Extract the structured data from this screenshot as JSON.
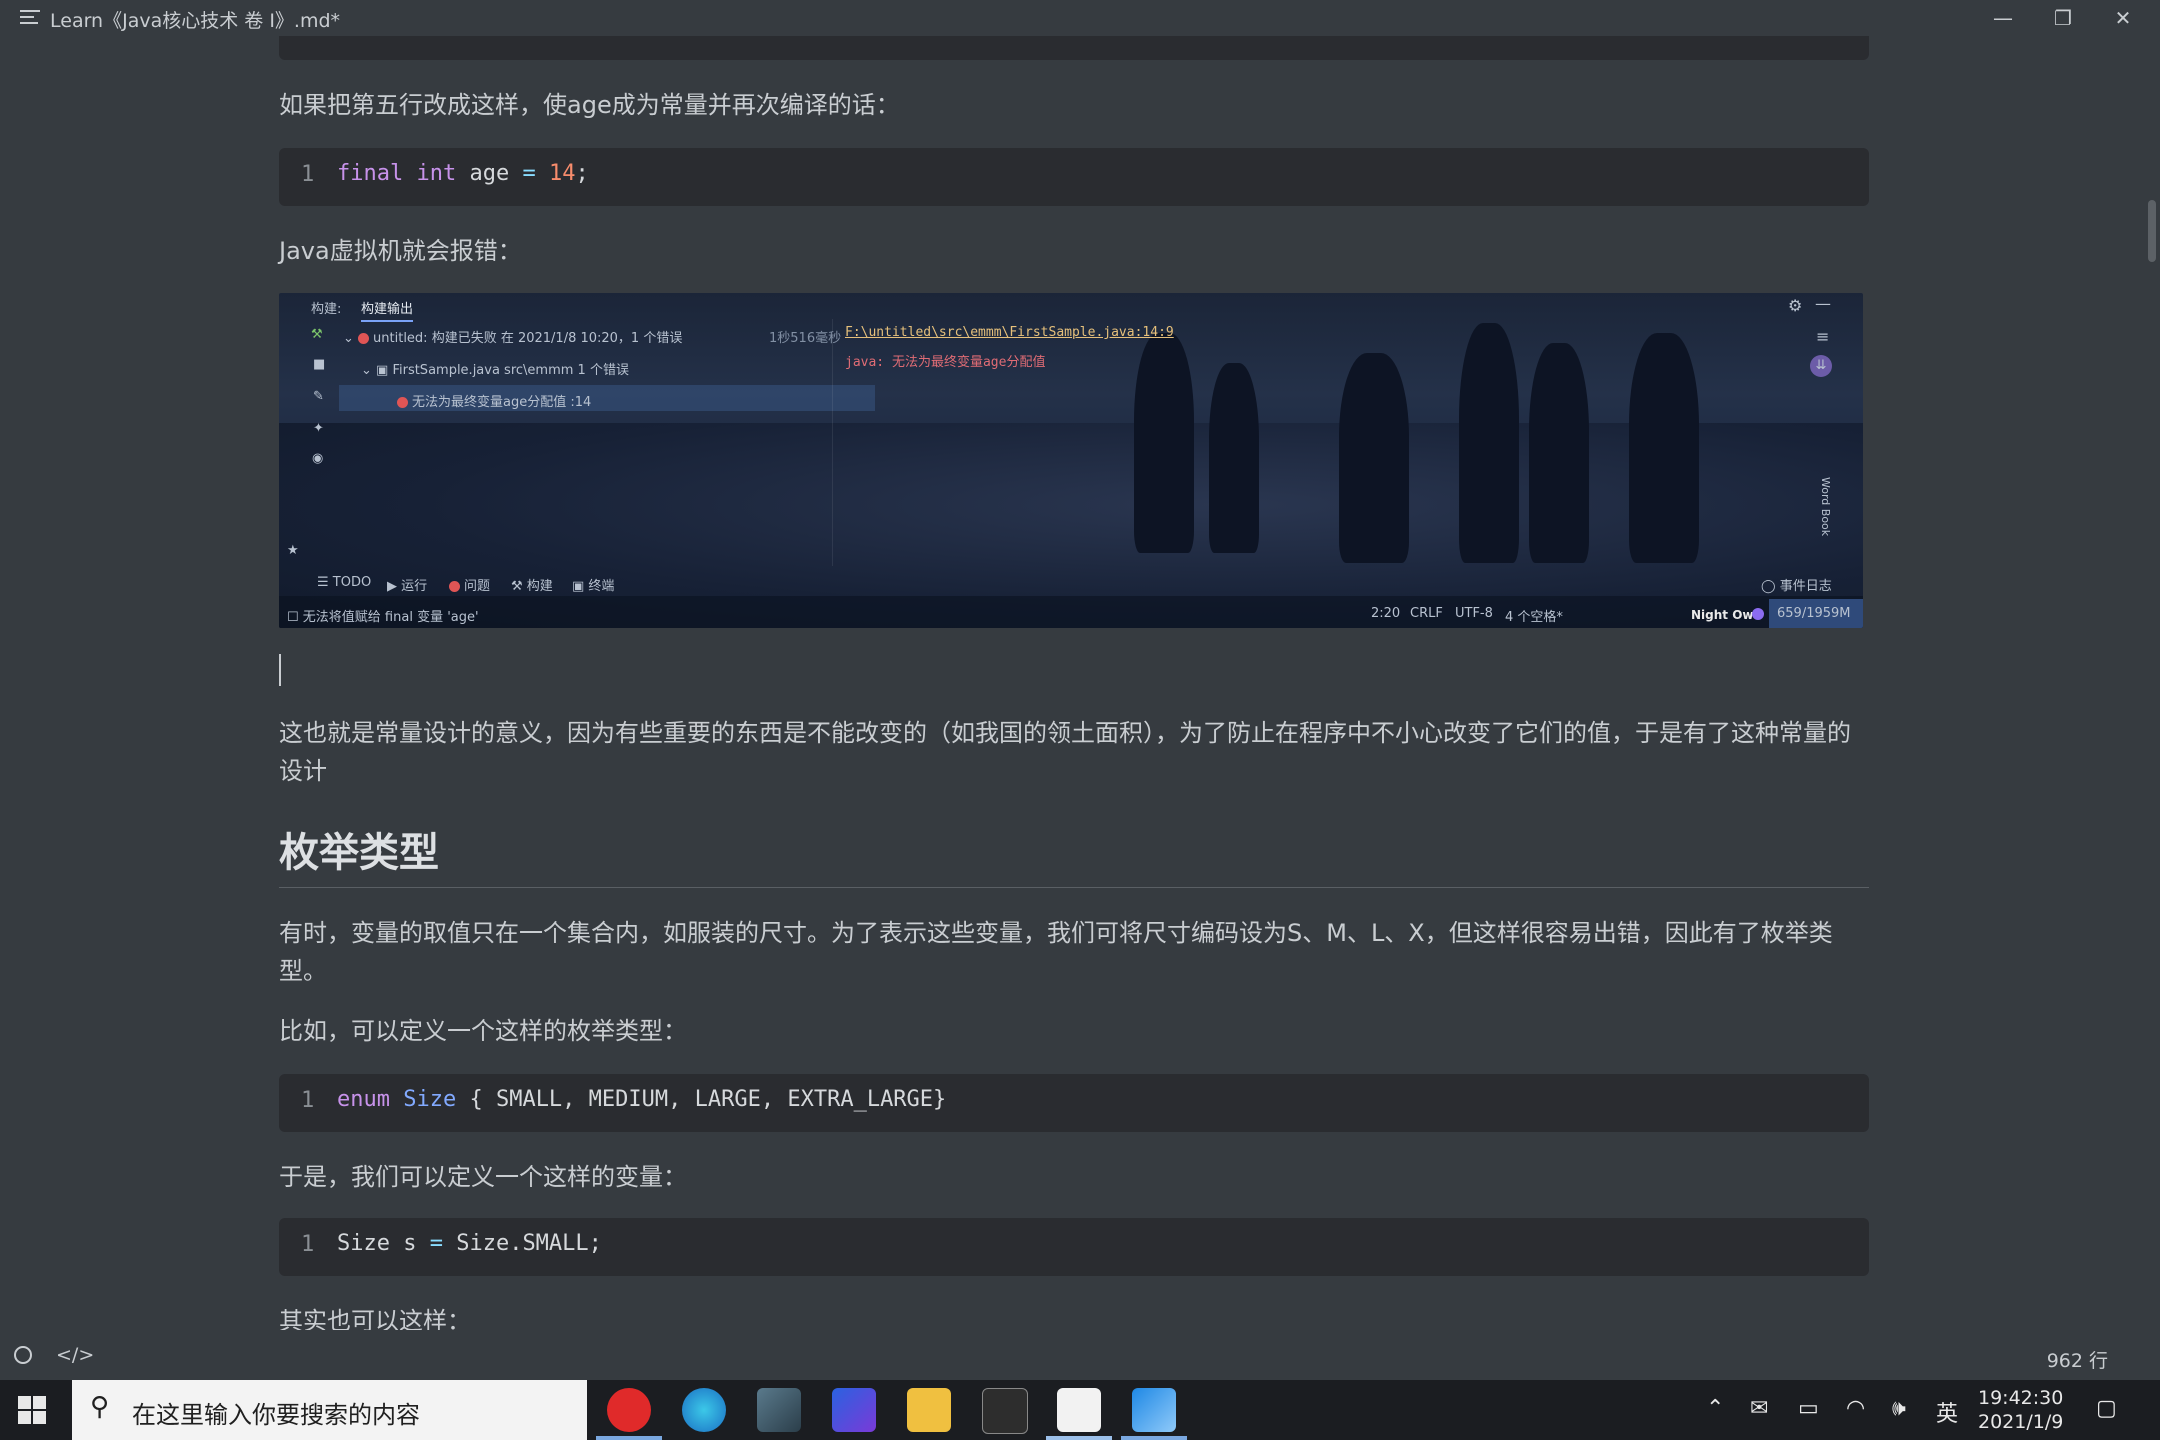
{
  "window": {
    "title": "Learn《Java核心技术 卷 I》.md*"
  },
  "content": {
    "p1": "如果把第五行改成这样，使age成为常量并再次编译的话：",
    "code1": {
      "line": "1",
      "tokens": [
        "final",
        "int",
        "age",
        "=",
        "14",
        ";"
      ]
    },
    "p2": "Java虚拟机就会报错：",
    "ide": {
      "tab_build": "构建:",
      "tab_output": "构建输出",
      "tree_root": "untitled: 构建已失败 在 2021/1/8 10:20，1 个错误",
      "tree_time": "1秒516毫秒",
      "tree_file": "FirstSample.java src\\emmm 1 个错误",
      "tree_error": "无法为最终变量age分配值 :14",
      "out_path": "F:\\untitled\\src\\emmm\\FirstSample.java:14:9",
      "out_error": "java: 无法为最终变量age分配值",
      "bottom_tabs": [
        "TODO",
        "运行",
        "问题",
        "构建",
        "终端"
      ],
      "event_log": "事件日志",
      "status_msg": "无法将值赋给 final 变量 'age'",
      "status_right": [
        "2:20",
        "CRLF",
        "UTF-8",
        "4 个空格*"
      ],
      "theme": "Night Owl",
      "memory": "659/1959M",
      "side_label": "Word Book"
    },
    "p3": "这也就是常量设计的意义，因为有些重要的东西是不能改变的（如我国的领土面积），为了防止在程序中不小心改变了它们的值，于是有了这种常量的设计",
    "h2": "枚举类型",
    "p4": " 有时，变量的取值只在一个集合内，如服装的尺寸。为了表示这些变量，我们可将尺寸编码设为S、M、L、X，但这样很容易出错，因此有了枚举类型。",
    "p5": "比如，可以定义一个这样的枚举类型：",
    "code2": {
      "line": "1",
      "kw": "enum",
      "ty": "Size",
      "rest": " { SMALL, MEDIUM, LARGE, EXTRA_LARGE}"
    },
    "p6": "于是，我们可以定义一个这样的变量：",
    "code3": {
      "line": "1",
      "a": "Size s ",
      "op": "=",
      "b": " Size.SMALL;"
    },
    "p7": "其实也可以这样："
  },
  "editor_status": {
    "line_count": "962 行"
  },
  "taskbar": {
    "search_placeholder": "在这里输入你要搜索的内容",
    "ime": "英",
    "time": "19:42:30",
    "date": "2021/1/9"
  }
}
